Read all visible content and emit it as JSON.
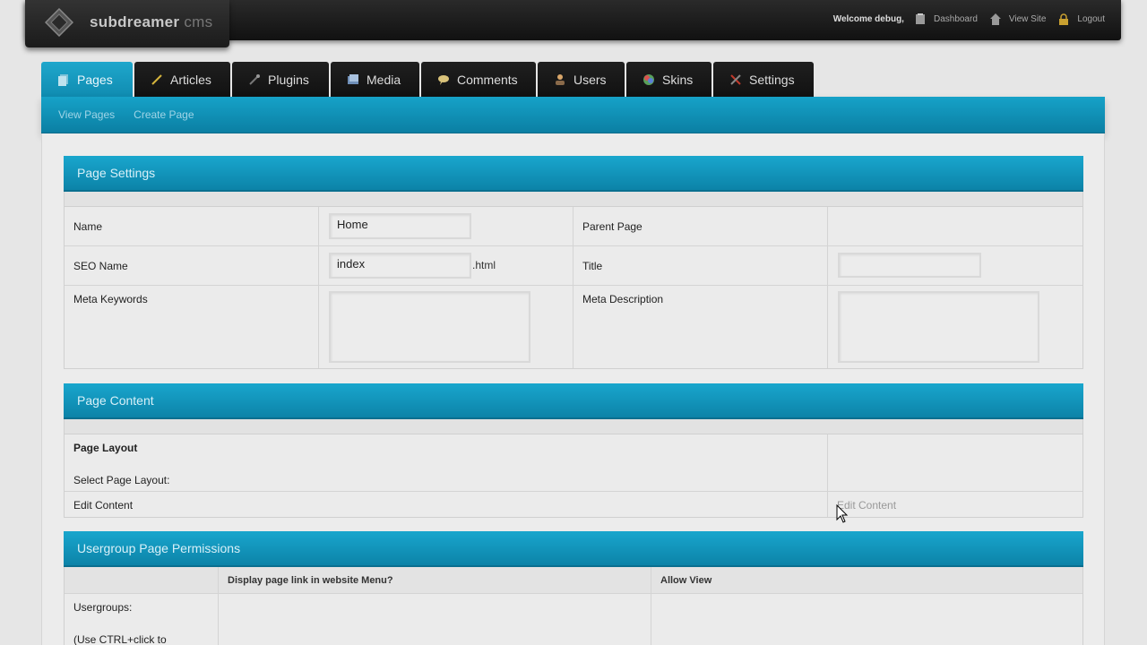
{
  "app": {
    "logo_text": "subdreamer",
    "logo_suffix": "cms"
  },
  "topbar": {
    "welcome": "Welcome debug,",
    "links": [
      "Dashboard",
      "View Site",
      "Logout"
    ]
  },
  "tabs": [
    {
      "label": "Pages",
      "icon": "pages-icon",
      "active": true
    },
    {
      "label": "Articles",
      "icon": "pencil-icon"
    },
    {
      "label": "Plugins",
      "icon": "plugin-icon"
    },
    {
      "label": "Media",
      "icon": "media-icon"
    },
    {
      "label": "Comments",
      "icon": "comment-icon"
    },
    {
      "label": "Users",
      "icon": "user-icon"
    },
    {
      "label": "Skins",
      "icon": "palette-icon"
    },
    {
      "label": "Settings",
      "icon": "tools-icon"
    }
  ],
  "subnav": [
    "View Pages",
    "Create Page"
  ],
  "page_settings": {
    "title": "Page Settings",
    "name_label": "Name",
    "name_value": "Home",
    "parent_label": "Parent Page",
    "seo_label": "SEO Name",
    "seo_value": "index",
    "seo_suffix": ".html",
    "title_label": "Title",
    "title_value": "",
    "meta_keywords_label": "Meta Keywords",
    "meta_description_label": "Meta Description"
  },
  "page_content": {
    "title": "Page Content",
    "layout_label": "Page Layout",
    "select_layout_label": "Select Page Layout:",
    "edit_content_label": "Edit Content",
    "edit_content_link": "Edit Content"
  },
  "permissions": {
    "title": "Usergroup Page Permissions",
    "col_display": "Display page link in website Menu?",
    "col_allow": "Allow View",
    "usergroups_label": "Usergroups:",
    "hint": "(Use CTRL+click to"
  },
  "colors": {
    "accent": "#1299c0",
    "topbar": "#1a1a1a",
    "background": "#e6e6e6"
  }
}
